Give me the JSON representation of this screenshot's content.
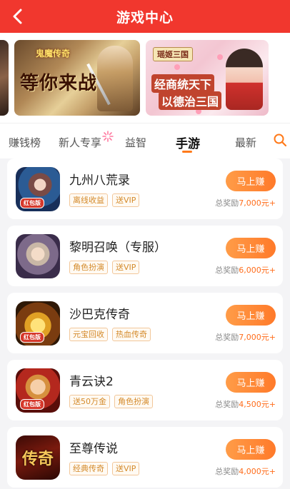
{
  "header": {
    "title": "游戏中心"
  },
  "banners": {
    "banner1": {
      "logo": "鬼魔传奇",
      "slogan": "等你来战"
    },
    "banner2": {
      "logo": "瑶姬三国",
      "line1": "经商统天下",
      "line2": "以德治三国"
    }
  },
  "tabs": [
    {
      "label": "赚钱榜"
    },
    {
      "label": "新人专享"
    },
    {
      "label": "益智"
    },
    {
      "label": "手游"
    },
    {
      "label": "最新"
    }
  ],
  "colors": {
    "header": "#f1372e",
    "accent": "#ff7a1a",
    "tag_text": "#d48a2a"
  },
  "games": [
    {
      "name": "九州八荒录",
      "tags": [
        "离线收益",
        "送VIP"
      ],
      "button": "马上赚",
      "reward_label": "总奖励",
      "reward_amount": "7,000元+",
      "icon_badge": "红包版"
    },
    {
      "name": "黎明召唤（专服）",
      "tags": [
        "角色扮演",
        "送VIP"
      ],
      "button": "马上赚",
      "reward_label": "总奖励",
      "reward_amount": "6,000元+",
      "icon_badge": ""
    },
    {
      "name": "沙巴克传奇",
      "tags": [
        "元宝回收",
        "热血传奇"
      ],
      "button": "马上赚",
      "reward_label": "总奖励",
      "reward_amount": "7,000元+",
      "icon_badge": "红包版"
    },
    {
      "name": "青云诀2",
      "tags": [
        "送50万金",
        "角色扮演"
      ],
      "button": "马上赚",
      "reward_label": "总奖励",
      "reward_amount": "4,500元+",
      "icon_badge": "红包版"
    },
    {
      "name": "至尊传说",
      "tags": [
        "经典传奇",
        "送VIP"
      ],
      "button": "马上赚",
      "reward_label": "总奖励",
      "reward_amount": "4,000元+",
      "icon_badge": "传奇"
    }
  ]
}
